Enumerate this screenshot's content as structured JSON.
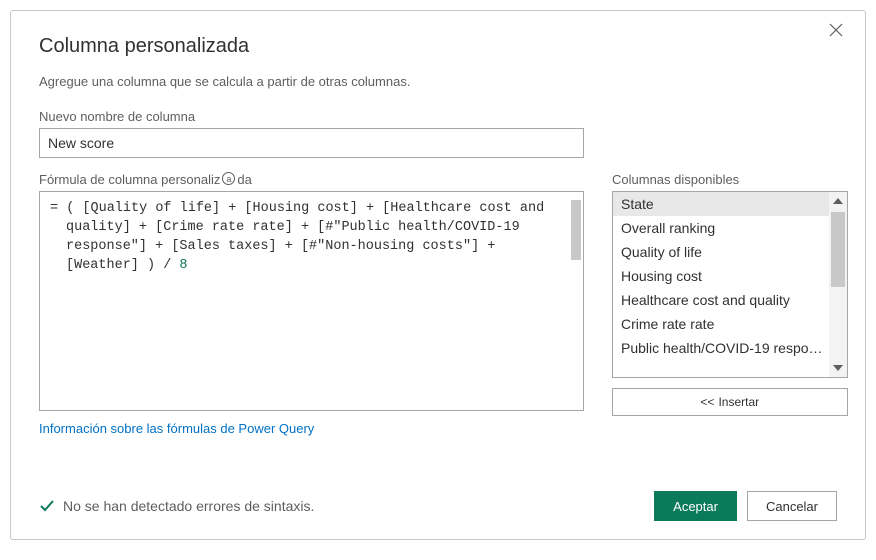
{
  "dialog": {
    "title": "Columna personalizada",
    "subtitle": "Agregue una columna que se calcula a partir de otras columnas."
  },
  "name_field": {
    "label": "Nuevo nombre de columna",
    "value": "New score"
  },
  "formula_field": {
    "label_pre": "Fórmula de columna personaliz",
    "label_post": "da",
    "prefix": "= ",
    "body": "( [Quality of life] + [Housing cost] + [Healthcare cost and quality] + [Crime rate rate] + [#\"Public health/COVID-19 response\"] + [Sales taxes] + [#\"Non-housing costs\"] + [Weather] ) / ",
    "number": "8"
  },
  "columns_panel": {
    "label": "Columnas disponibles",
    "items": [
      "State",
      "Overall ranking",
      "Quality of life",
      "Housing cost",
      "Healthcare cost and quality",
      "Crime rate rate",
      "Public health/COVID-19 respo…"
    ],
    "selected_index": 0,
    "insert_label": "Insertar"
  },
  "link_text": "Información sobre las fórmulas de Power Query",
  "status_text": "No se han detectado errores de sintaxis.",
  "buttons": {
    "ok": "Aceptar",
    "cancel": "Cancelar"
  }
}
